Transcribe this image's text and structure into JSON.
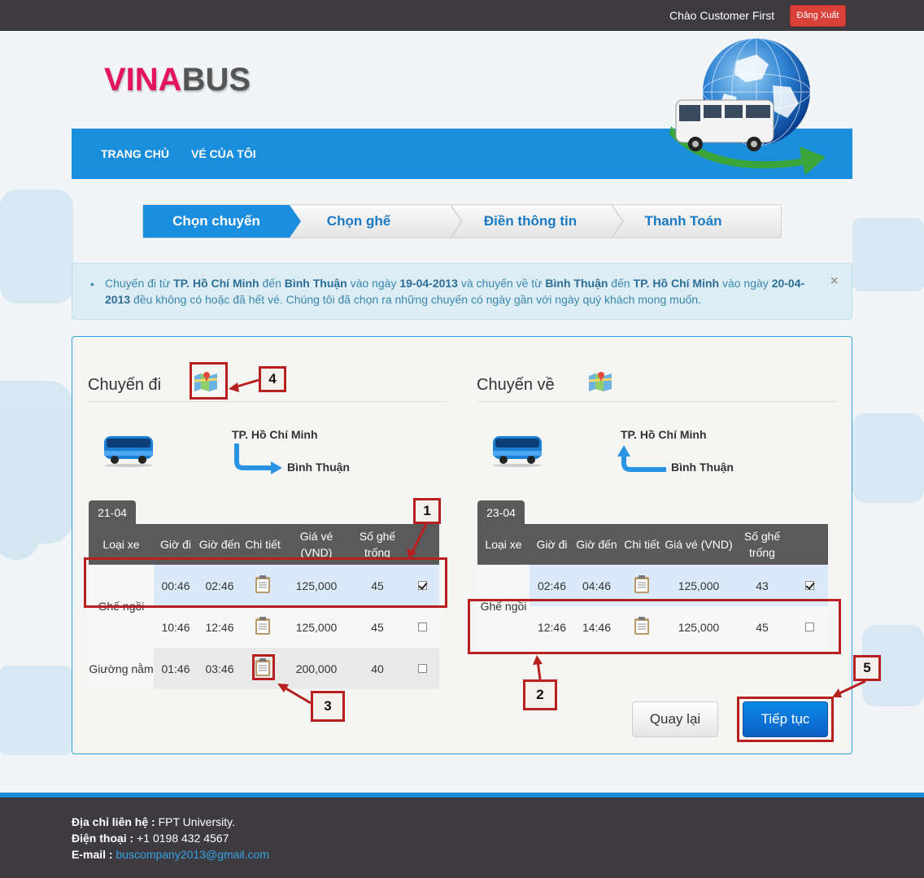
{
  "header": {
    "greeting": "Chào Customer First",
    "logout_label": "Đăng Xuất",
    "logo_part1": "VINA",
    "logo_part2": "BUS"
  },
  "nav": {
    "items": [
      {
        "label": "TRANG CHỦ"
      },
      {
        "label": "VÉ CỦA TÔI"
      }
    ]
  },
  "steps": [
    {
      "label": "Chọn chuyến",
      "active": true
    },
    {
      "label": "Chọn ghế",
      "active": false
    },
    {
      "label": "Điền thông tin",
      "active": false
    },
    {
      "label": "Thanh Toán",
      "active": false
    }
  ],
  "alert": {
    "t1": "Chuyến đi từ ",
    "from1": "TP. Hồ Chí Minh",
    "t2": " đến ",
    "to1": "Bình Thuận",
    "t3": " vào ngày ",
    "date1": "19-04-2013",
    "t4": " và chuyến về từ ",
    "from2": "Bình Thuận",
    "t5": " đến ",
    "to2": "TP. Hồ Chí Minh",
    "t6": " vào ngày ",
    "date2": "20-04-2013",
    "t7": " đều không có hoặc đã hết vé. Chúng tôi đã chọn ra những chuyến có ngày gần với ngày quý khách mong muốn.",
    "close": "×"
  },
  "outbound": {
    "title": "Chuyến đi",
    "from": "TP. Hồ Chí Minh",
    "to": "Bình Thuận",
    "date_tab": "21-04",
    "columns": [
      "Loại xe",
      "Giờ đi",
      "Giờ đến",
      "Chi tiết",
      "Giá vé (VND)",
      "Số ghế trống"
    ],
    "group1_type": "Ghế ngồi",
    "rows": [
      {
        "depart": "00:46",
        "arrive": "02:46",
        "price": "125,000",
        "seats": "45",
        "checked": true
      },
      {
        "depart": "10:46",
        "arrive": "12:46",
        "price": "125,000",
        "seats": "45",
        "checked": false
      },
      {
        "type": "Giường nằm",
        "depart": "01:46",
        "arrive": "03:46",
        "price": "200,000",
        "seats": "40",
        "checked": false
      }
    ]
  },
  "return": {
    "title": "Chuyến về",
    "from": "TP. Hồ Chí Minh",
    "to": "Bình Thuận",
    "date_tab": "23-04",
    "columns": [
      "Loại xe",
      "Giờ đi",
      "Giờ đến",
      "Chi tiết",
      "Giá vé (VND)",
      "Số ghế trống"
    ],
    "group1_type": "Ghế ngồi",
    "rows": [
      {
        "depart": "02:46",
        "arrive": "04:46",
        "price": "125,000",
        "seats": "43",
        "checked": true
      },
      {
        "depart": "12:46",
        "arrive": "14:46",
        "price": "125,000",
        "seats": "45",
        "checked": false
      }
    ]
  },
  "buttons": {
    "back": "Quay lại",
    "next": "Tiếp tục"
  },
  "annotations": [
    "1",
    "2",
    "3",
    "4",
    "5"
  ],
  "footer": {
    "address_label": "Địa chỉ liên hệ :",
    "address": " FPT University.",
    "phone_label": "Điện thoại :",
    "phone": " +1 0198 432 4567",
    "email_label": "E-mail :",
    "email": "buscompany2013@gmail.com"
  },
  "colors": {
    "brand_blue": "#1a8ddb",
    "logo_red": "#e3145c",
    "annotation_red": "#b82020",
    "logout_red": "#d9413a"
  }
}
